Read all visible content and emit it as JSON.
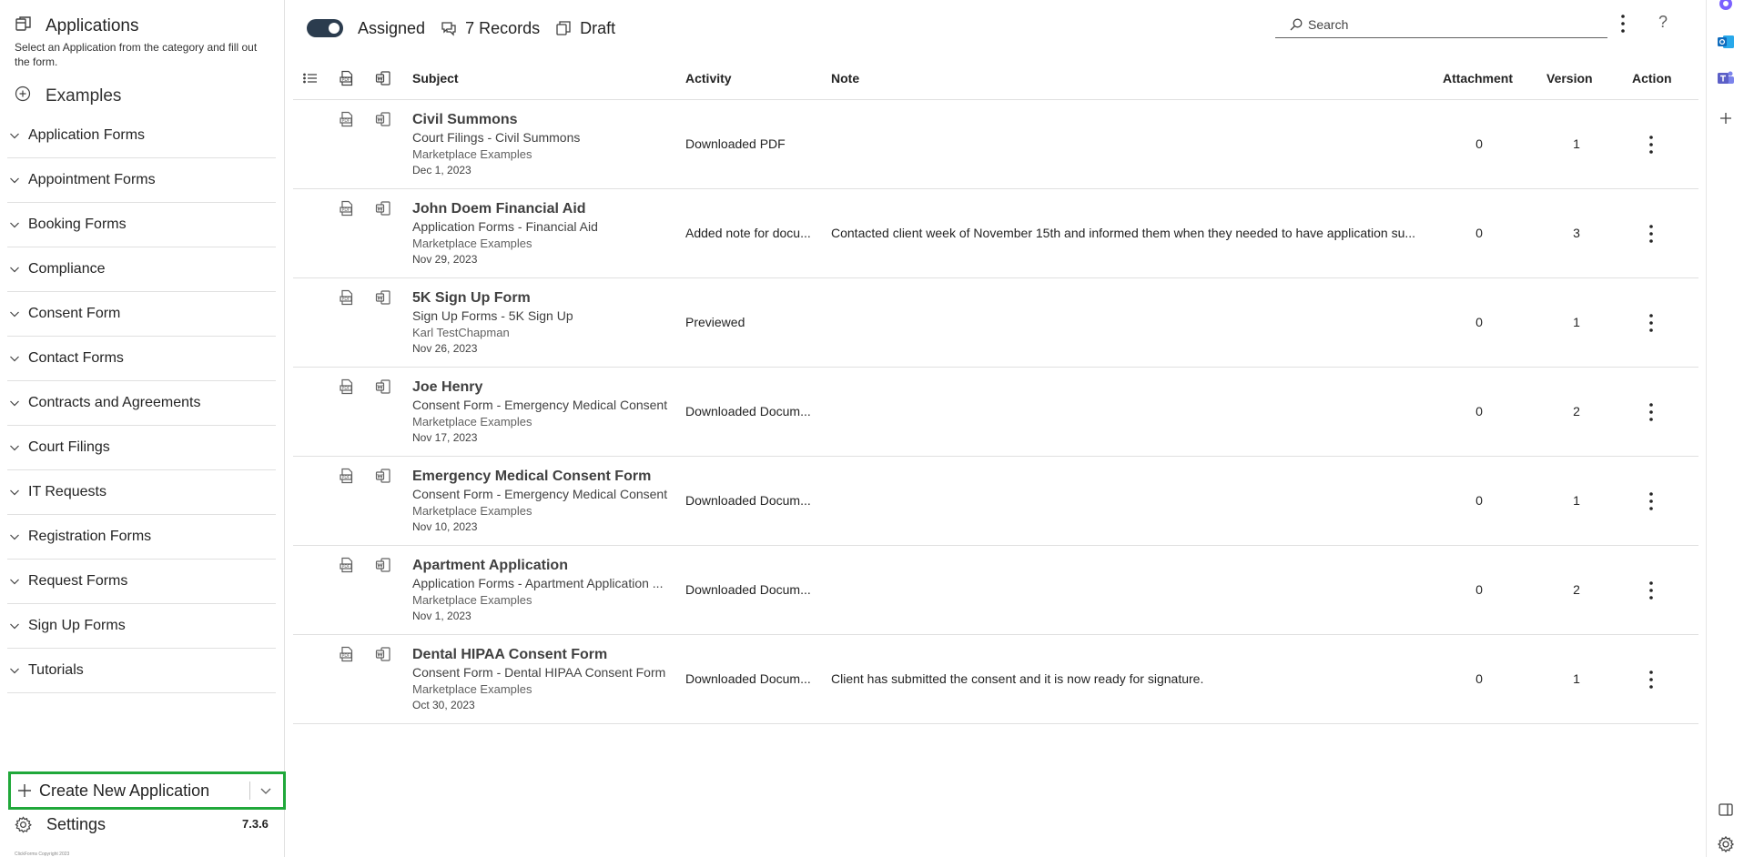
{
  "sidebar": {
    "title": "Applications",
    "subtitle": "Select an Application from the category and fill out the form.",
    "examples_label": "Examples",
    "categories": [
      "Application Forms",
      "Appointment Forms",
      "Booking Forms",
      "Compliance",
      "Consent Form",
      "Contact Forms",
      "Contracts and Agreements",
      "Court Filings",
      "IT Requests",
      "Registration Forms",
      "Request Forms",
      "Sign Up Forms",
      "Tutorials"
    ],
    "create_label": "Create New Application",
    "settings_label": "Settings",
    "version": "7.3.6",
    "footer": "ClickForms Copyright 2023"
  },
  "toolbar": {
    "assigned_label": "Assigned",
    "records_label": "7 Records",
    "draft_label": "Draft",
    "search_placeholder": "Search",
    "help_label": "?"
  },
  "table": {
    "headers": {
      "subject": "Subject",
      "activity": "Activity",
      "note": "Note",
      "attachment": "Attachment",
      "version": "Version",
      "action": "Action"
    },
    "rows": [
      {
        "title": "Civil Summons",
        "category": "Court Filings - Civil Summons",
        "owner": "Marketplace Examples",
        "date": "Dec 1, 2023",
        "activity": "Downloaded PDF",
        "note": "",
        "attachment": "0",
        "version": "1"
      },
      {
        "title": "John Doem Financial Aid",
        "category": "Application Forms - Financial Aid",
        "owner": "Marketplace Examples",
        "date": "Nov 29, 2023",
        "activity": "Added note for docu...",
        "note": "Contacted client week of November 15th and informed them when they needed to have application su...",
        "attachment": "0",
        "version": "3"
      },
      {
        "title": "5K Sign Up Form",
        "category": "Sign Up Forms - 5K Sign Up",
        "owner": "Karl TestChapman",
        "date": "Nov 26, 2023",
        "activity": "Previewed",
        "note": "",
        "attachment": "0",
        "version": "1"
      },
      {
        "title": "Joe Henry",
        "category": "Consent Form - Emergency Medical Consent",
        "owner": "Marketplace Examples",
        "date": "Nov 17, 2023",
        "activity": "Downloaded Docum...",
        "note": "",
        "attachment": "0",
        "version": "2"
      },
      {
        "title": "Emergency Medical Consent Form",
        "category": "Consent Form - Emergency Medical Consent",
        "owner": "Marketplace Examples",
        "date": "Nov 10, 2023",
        "activity": "Downloaded Docum...",
        "note": "",
        "attachment": "0",
        "version": "1"
      },
      {
        "title": "Apartment Application",
        "category": "Application Forms - Apartment Application ...",
        "owner": "Marketplace Examples",
        "date": "Nov 1, 2023",
        "activity": "Downloaded Docum...",
        "note": "",
        "attachment": "0",
        "version": "2"
      },
      {
        "title": "Dental HIPAA Consent Form",
        "category": "Consent Form - Dental HIPAA Consent Form",
        "owner": "Marketplace Examples",
        "date": "Oct 30, 2023",
        "activity": "Downloaded Docum...",
        "note": "Client has submitted the consent and it is now ready for signature.",
        "attachment": "0",
        "version": "1"
      }
    ]
  },
  "colors": {
    "accent_green": "#20a83a",
    "toggle_on": "#2b3c4e",
    "outlook_blue": "#0f6cbd",
    "teams_purple": "#5b5fc7"
  },
  "rail_icons": [
    "copilot-icon",
    "outlook-icon",
    "teams-icon",
    "add-icon",
    "panel-icon",
    "settings-icon"
  ]
}
